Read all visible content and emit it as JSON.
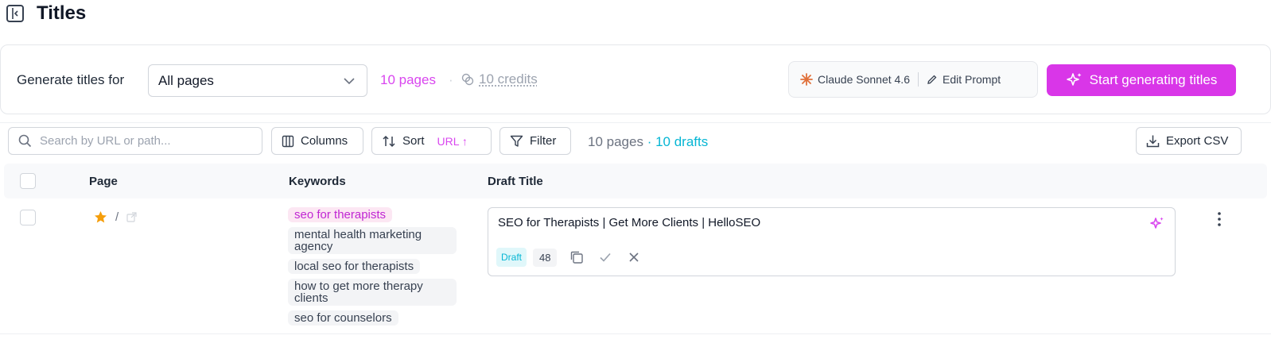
{
  "header": {
    "title": "Titles",
    "collapse_icon": "sidebar-collapse-icon"
  },
  "generate": {
    "label": "Generate titles for",
    "select_value": "All pages",
    "pages_count": "10 pages",
    "separator": "·",
    "credits": "10 credits",
    "model": "Claude Sonnet 4.6",
    "edit_prompt": "Edit Prompt",
    "start_label": "Start generating titles",
    "accent_color": "#d936e8"
  },
  "toolbar": {
    "search_placeholder": "Search by URL or path...",
    "columns_label": "Columns",
    "sort_label": "Sort",
    "sort_badge": "URL ↑",
    "filter_label": "Filter",
    "summary_pages": "10 pages",
    "summary_drafts": "· 10 drafts",
    "export_label": "Export CSV"
  },
  "table": {
    "columns": [
      "Page",
      "Keywords",
      "Draft Title"
    ],
    "rows": [
      {
        "page": "/",
        "keywords": [
          "seo for therapists",
          "mental health marketing agency",
          "local seo for therapists",
          "how to get more therapy clients",
          "seo for counselors"
        ],
        "draft_title": "SEO for Therapists | Get More Clients | HelloSEO",
        "status": "Draft",
        "char_count": "48"
      }
    ]
  }
}
